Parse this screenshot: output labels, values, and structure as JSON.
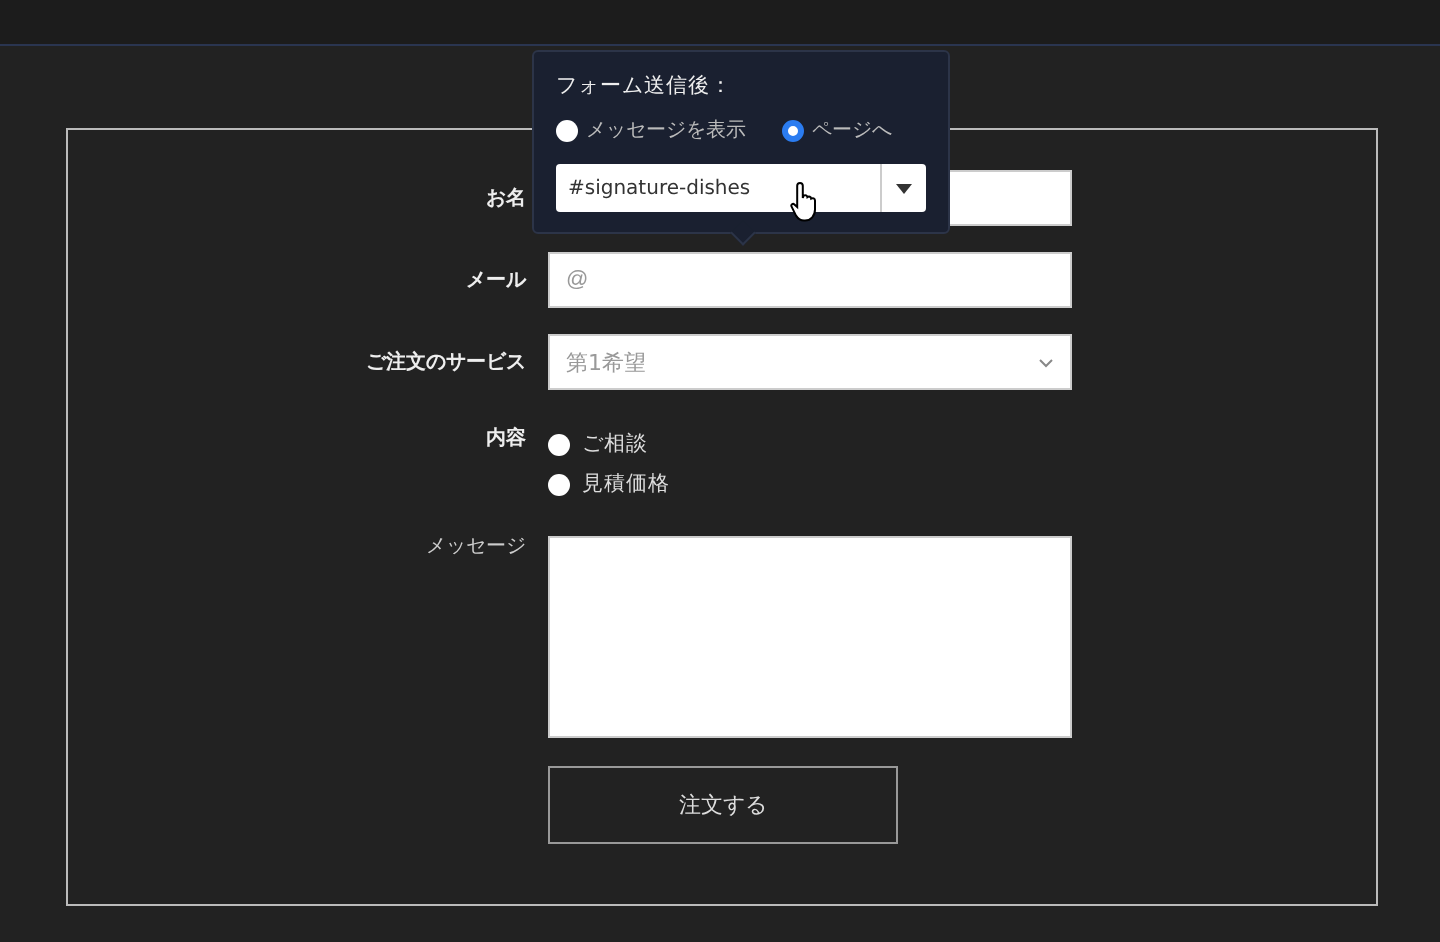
{
  "form": {
    "fields": [
      {
        "kind": "text",
        "label": "お名",
        "bold": true
      },
      {
        "kind": "text",
        "label": "メール",
        "bold": true,
        "placeholder": "@"
      },
      {
        "kind": "select",
        "label": "ご注文のサービス",
        "bold": true,
        "placeholder": "第1希望"
      },
      {
        "kind": "radio",
        "label": "内容",
        "bold": true,
        "options": [
          {
            "label": "ご相談",
            "selected": false
          },
          {
            "label": "見積価格",
            "selected": false
          }
        ]
      },
      {
        "kind": "textarea",
        "label": "メッセージ",
        "bold": false
      }
    ],
    "submit": "注文する"
  },
  "popover": {
    "title": "フォーム送信後：",
    "options": [
      {
        "label": "メッセージを表示",
        "selected": false
      },
      {
        "label": "ページへ",
        "selected": true
      }
    ],
    "value": "#signature-dishes"
  }
}
